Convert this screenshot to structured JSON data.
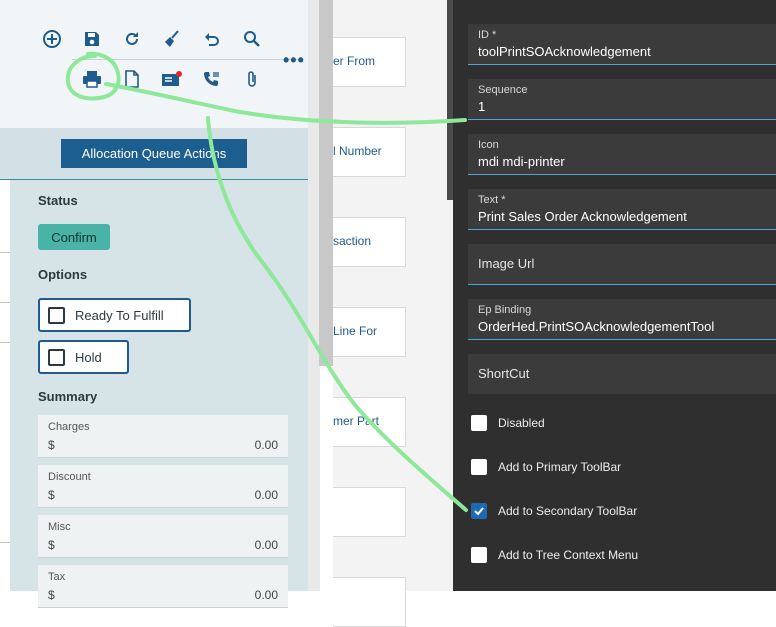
{
  "toolbar": {
    "icons_row1": [
      "add-circle-icon",
      "save-icon",
      "refresh-icon",
      "clear-broom-icon",
      "undo-icon",
      "search-icon"
    ],
    "icons_row2": [
      "printer-icon",
      "document-icon",
      "notification-card-icon",
      "phone-icon",
      "attachment-icon"
    ],
    "more_label": "•••"
  },
  "middle": {
    "labels": [
      "er From",
      "l Number",
      "saction",
      "Line For",
      "mer Part"
    ]
  },
  "panel": {
    "alloc_button": "Allocation Queue Actions",
    "status_title": "Status",
    "status_value": "Confirm",
    "options_title": "Options",
    "option_ready": "Ready To Fulfill",
    "option_hold": "Hold",
    "summary_title": "Summary",
    "summary": [
      {
        "label": "Charges",
        "currency": "$",
        "value": "0.00"
      },
      {
        "label": "Discount",
        "currency": "$",
        "value": "0.00"
      },
      {
        "label": "Misc",
        "currency": "$",
        "value": "0.00"
      },
      {
        "label": "Tax",
        "currency": "$",
        "value": "0.00"
      }
    ]
  },
  "props": {
    "fields": [
      {
        "label": "ID *",
        "value": "toolPrintSOAcknowledgement"
      },
      {
        "label": "Sequence",
        "value": "1"
      },
      {
        "label": "Icon",
        "value": "mdi mdi-printer"
      },
      {
        "label": "Text *",
        "value": "Print Sales Order Acknowledgement"
      },
      {
        "label": "",
        "value": "Image Url"
      },
      {
        "label": "Ep Binding",
        "value": "OrderHed.PrintSOAcknowledgementTool"
      },
      {
        "label": "",
        "value": "ShortCut"
      }
    ],
    "checkboxes": [
      {
        "label": "Disabled",
        "checked": false
      },
      {
        "label": "Add to Primary ToolBar",
        "checked": false
      },
      {
        "label": "Add to Secondary ToolBar",
        "checked": true
      },
      {
        "label": "Add to Tree Context Menu",
        "checked": false
      }
    ]
  },
  "colors": {
    "accent": "#1b5e8f",
    "annotation": "#8ee89a",
    "dark_bg": "#2f2f2f",
    "status_badge": "#48b3a6"
  }
}
